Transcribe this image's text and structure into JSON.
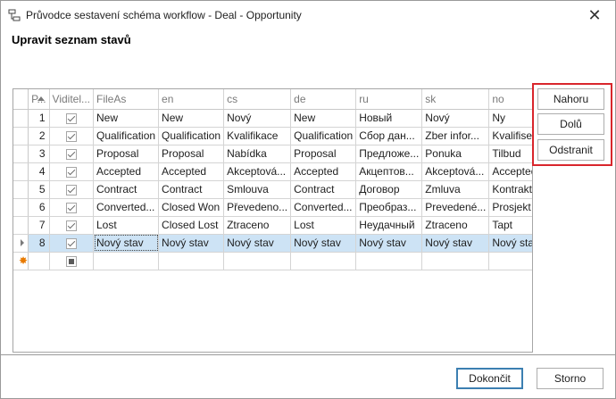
{
  "window": {
    "title": "Průvodce sestavení schéma workflow - Deal - Opportunity",
    "close_glyph": "✕"
  },
  "heading": "Upravit seznam stavů",
  "grid": {
    "columns": [
      "P...",
      "Viditel...",
      "FileAs",
      "en",
      "cs",
      "de",
      "ru",
      "sk",
      "no"
    ],
    "rows": [
      {
        "pos": "1",
        "visible": true,
        "fileas": "New",
        "en": "New",
        "cs": "Nový",
        "de": "New",
        "ru": "Новый",
        "sk": "Nový",
        "no": "Ny"
      },
      {
        "pos": "2",
        "visible": true,
        "fileas": "Qualification",
        "en": "Qualification",
        "cs": "Kvalifikace",
        "de": "Qualification",
        "ru": "Сбор дан...",
        "sk": "Zber infor...",
        "no": "Kvalifisering"
      },
      {
        "pos": "3",
        "visible": true,
        "fileas": "Proposal",
        "en": "Proposal",
        "cs": "Nabídka",
        "de": "Proposal",
        "ru": "Предложе...",
        "sk": "Ponuka",
        "no": "Tilbud"
      },
      {
        "pos": "4",
        "visible": true,
        "fileas": "Accepted",
        "en": "Accepted",
        "cs": "Akceptová...",
        "de": "Accepted",
        "ru": "Акцептов...",
        "sk": "Akceptová...",
        "no": "Accepted"
      },
      {
        "pos": "5",
        "visible": true,
        "fileas": "Contract",
        "en": "Contract",
        "cs": "Smlouva",
        "de": "Contract",
        "ru": "Договор",
        "sk": "Zmluva",
        "no": "Kontrakt"
      },
      {
        "pos": "6",
        "visible": true,
        "fileas": "Converted...",
        "en": "Closed Won",
        "cs": "Převedeno...",
        "de": "Converted...",
        "ru": "Преобраз...",
        "sk": "Prevedené...",
        "no": "Prosjekt"
      },
      {
        "pos": "7",
        "visible": true,
        "fileas": "Lost",
        "en": "Closed Lost",
        "cs": "Ztraceno",
        "de": "Lost",
        "ru": "Неудачный",
        "sk": "Ztraceno",
        "no": "Tapt"
      },
      {
        "pos": "8",
        "visible": true,
        "fileas": "Nový stav",
        "en": "Nový stav",
        "cs": "Nový stav",
        "de": "Nový stav",
        "ru": "Nový stav",
        "sk": "Nový stav",
        "no": "Nový stav"
      }
    ],
    "new_row_marker": "✸"
  },
  "side_buttons": {
    "up": "Nahoru",
    "down": "Dolů",
    "remove": "Odstranit"
  },
  "footer": {
    "finish": "Dokončit",
    "cancel": "Storno"
  },
  "colors": {
    "selection": "#cde3f5",
    "highlight_box": "#d9262c",
    "default_button_border": "#3c7fb1"
  }
}
